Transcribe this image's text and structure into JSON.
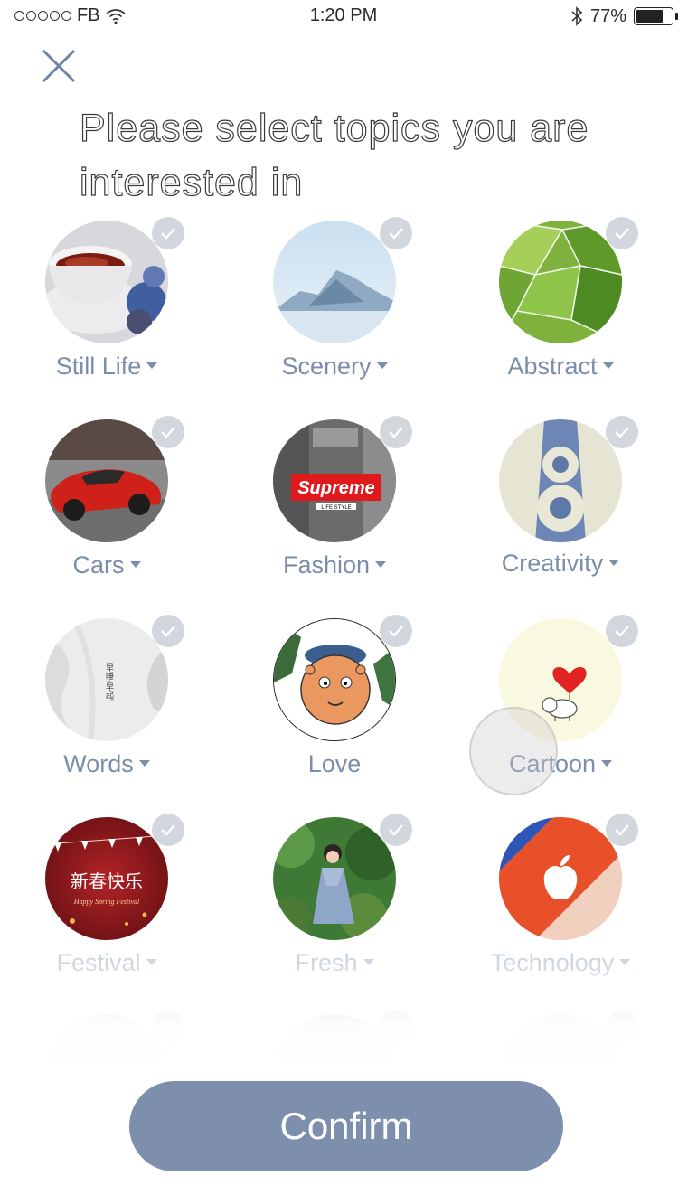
{
  "status_bar": {
    "carrier": "FB",
    "time": "1:20 PM",
    "battery_percent": "77%",
    "battery_level": 0.77
  },
  "header": {
    "close_icon": "close-icon",
    "title": "Please select topics you are interested in"
  },
  "topics": [
    {
      "label": "Still Life",
      "dropdown": true,
      "image": "teacup"
    },
    {
      "label": "Scenery",
      "dropdown": true,
      "image": "mountain"
    },
    {
      "label": "Abstract",
      "dropdown": true,
      "image": "green-mesh"
    },
    {
      "label": "Cars",
      "dropdown": true,
      "image": "red-car"
    },
    {
      "label": "Fashion",
      "dropdown": true,
      "image": "supreme-city",
      "image_text": "Supreme",
      "image_subtext": "LIFE STYLE"
    },
    {
      "label": "Creativity",
      "dropdown": true,
      "image": "number-eight"
    },
    {
      "label": "Words",
      "dropdown": true,
      "image": "white-fabric",
      "image_text": "早睡·早起。"
    },
    {
      "label": "Love",
      "dropdown": false,
      "image": "cartoon-face"
    },
    {
      "label": "Cartoon",
      "dropdown": true,
      "image": "elephant-heart"
    },
    {
      "label": "Festival",
      "dropdown": true,
      "image": "spring-festival",
      "image_text": "新春快乐",
      "image_subtext": "Happy Spring Festival"
    },
    {
      "label": "Fresh",
      "dropdown": true,
      "image": "girl-forest"
    },
    {
      "label": "Technology",
      "dropdown": true,
      "image": "apple-logo"
    }
  ],
  "confirm_label": "Confirm",
  "colors": {
    "accent": "#7d8fad",
    "label": "#7b8dab",
    "check_bg": "#d2d6dd"
  }
}
